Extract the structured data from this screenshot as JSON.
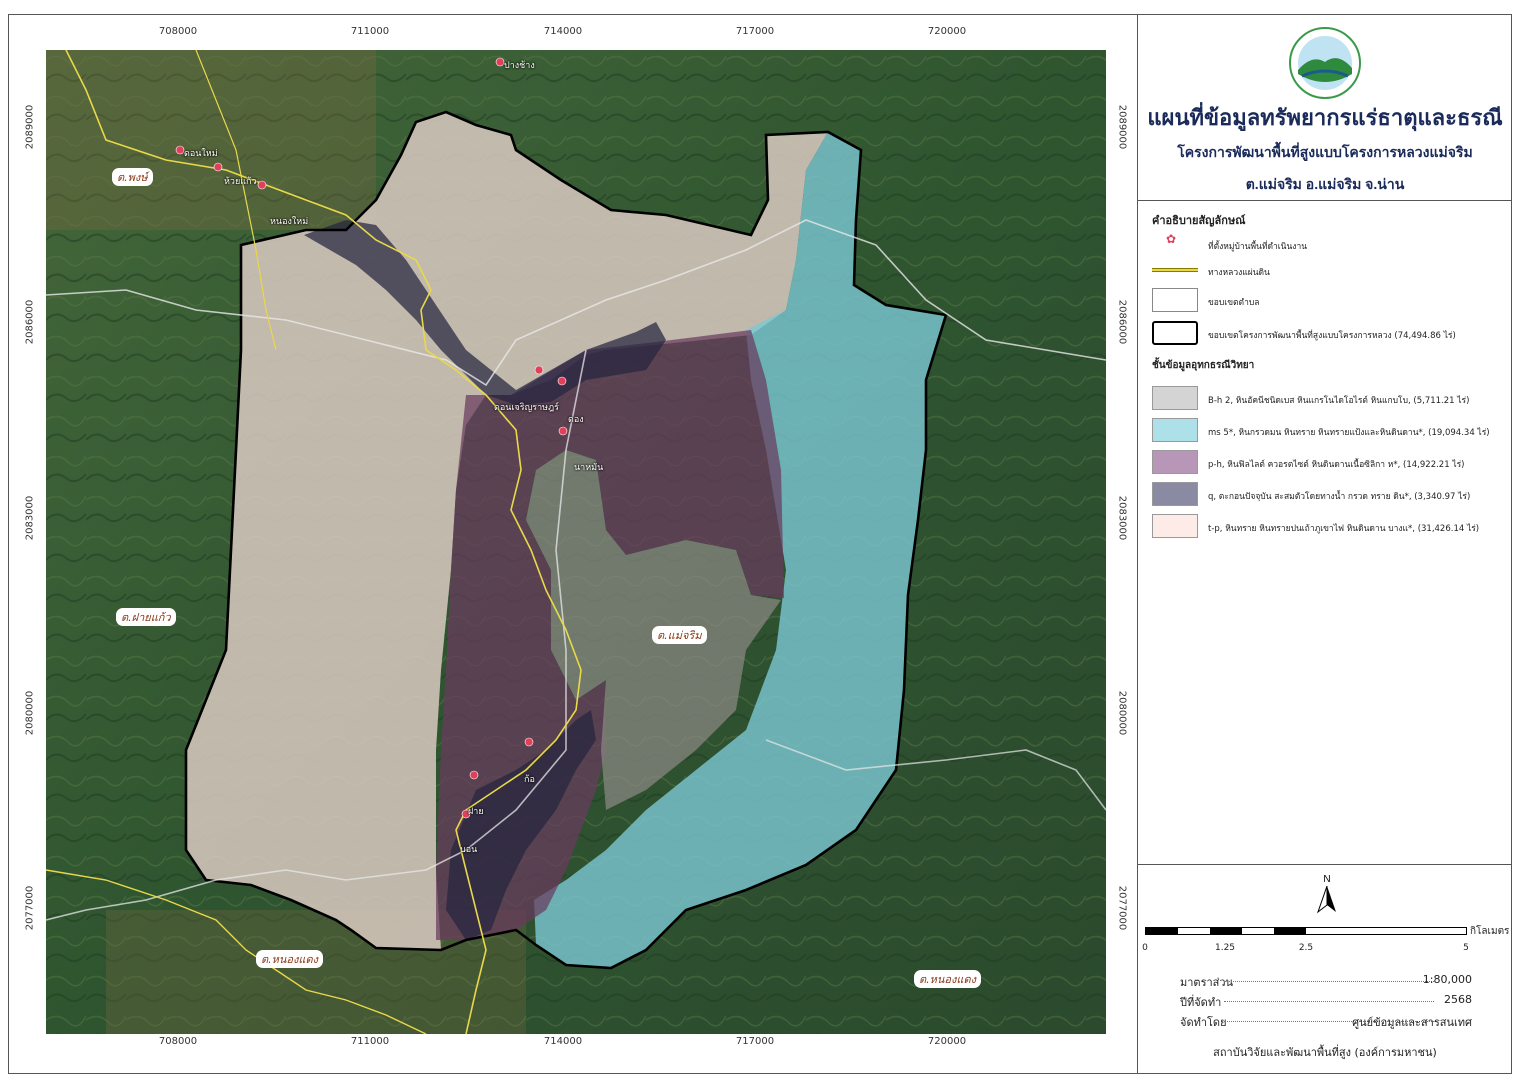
{
  "map": {
    "top_ticks": [
      "708000",
      "711000",
      "714000",
      "717000",
      "720000"
    ],
    "bottom_ticks": [
      "708000",
      "711000",
      "714000",
      "717000",
      "720000"
    ],
    "left_ticks": [
      "2089000",
      "2086000",
      "2083000",
      "2080000",
      "2077000"
    ],
    "right_ticks": [
      "2089000",
      "2086000",
      "2083000",
      "2080000",
      "2077000"
    ],
    "village_labels": [
      "ปางช้าง",
      "ดอนใหม่",
      "ห้วยแก้ว",
      "หนองใหม่",
      "ดอนเจริญราษฎร์",
      "ดอง",
      "นาหมัน",
      "ก้อ",
      "ฝาย",
      "บอน"
    ],
    "tambon_labels": [
      "ต.พงษ์",
      "ต.ฝายแก้ว",
      "ต.แม่จริม",
      "ต.หนองแดง",
      "ต.หนองแดง"
    ]
  },
  "title": {
    "main": "แผนที่ข้อมูลทรัพยากรแร่ธาตุและธรณี",
    "sub": "โครงการพัฒนาพื้นที่สูงแบบโครงการหลวงแม่จริม",
    "location": "ต.แม่จริม อ.แม่จริม จ.น่าน"
  },
  "legend": {
    "heading": "คำอธิบายสัญลักษณ์",
    "items": [
      {
        "label": "ที่ตั้งหมู่บ้านพื้นที่ดำเนินงาน",
        "icon": "village-star-icon",
        "color": "#e0405a"
      },
      {
        "label": "ทางหลวงแผ่นดิน",
        "color": "#e8d84a"
      },
      {
        "label": "ขอบเขตตำบล",
        "color": "#ffffff"
      },
      {
        "label": "ขอบเขตโครงการพัฒนาพื้นที่สูงแบบโครงการหลวง (74,494.86 ไร่)",
        "color": "#000000"
      }
    ],
    "geology_heading": "ชั้นข้อมูลอุทกธรณีวิทยา",
    "geology_items": [
      {
        "label": "B-h 2, หินอัคนีชนิดเบส หินแกรโนไดโอไรต์ หินแกบโบ, (5,711.21 ไร่)",
        "color": "#d4d4d4"
      },
      {
        "label": "ms 5*, หินกรวดมน หินทราย หินทรายแป้งและหินดินดาน*, (19,094.34 ไร่)",
        "color": "#ade0e8"
      },
      {
        "label": "p-h, หินฟิลไลต์ ควอรตไซต์ หินดินดานเนื้อซิลิกา ห*, (14,922.21 ไร่)",
        "color": "#b896b8"
      },
      {
        "label": "q, ตะกอนปัจจุบัน สะสมตัวโดยทางน้ำ กรวด ทราย ดิน*, (3,340.97 ไร่)",
        "color": "#8a8aa2"
      },
      {
        "label": "t-p, หินทราย หินทรายปนเถ้าภูเขาไฟ หินดินดาน บางแ*, (31,426.14 ไร่)",
        "color": "#fcebe6"
      }
    ]
  },
  "scale": {
    "ticks": [
      "0",
      "1.25",
      "2.5",
      "5"
    ],
    "unit": "กิโลเมตร"
  },
  "meta": {
    "scale_label": "มาตราส่วน",
    "scale_value": "1:80,000",
    "year_label": "ปีที่จัดทำ",
    "year_value": "2568",
    "by_label": "จัดทำโดย",
    "by_value": "ศูนย์ข้อมูลและสารสนเทศ"
  },
  "footer": "สถาบันวิจัยและพัฒนาพื้นที่สูง (องค์การมหาชน)"
}
